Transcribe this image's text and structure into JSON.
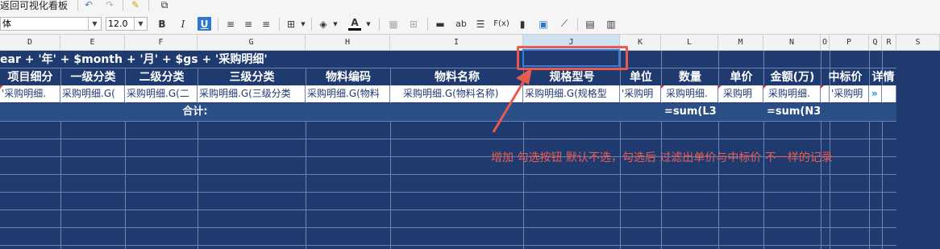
{
  "toolbar": {
    "back_label": "返回可视化看板",
    "font_name": "体",
    "font_size": "12.0",
    "bold": "B",
    "italic": "I",
    "underline": "U",
    "text_btn": "ab",
    "fx_btn": "F(x)",
    "font_color_glyph": "A"
  },
  "columns": [
    "D",
    "E",
    "F",
    "G",
    "H",
    "I",
    "J",
    "K",
    "L",
    "M",
    "N",
    "O",
    "P",
    "Q",
    "R",
    "S"
  ],
  "title_row": "ear + '年' + $month + '月' + $gs + '采购明细'",
  "headers": [
    "项目细分",
    "一级分类",
    "二级分类",
    "三级分类",
    "物料编码",
    "物料名称",
    "规格型号",
    "单位",
    "数量",
    "单价",
    "金额(万)",
    "中标价",
    "详情"
  ],
  "data_row": [
    "'采购明细.",
    "采购明细.G(",
    "采购明细.G(二",
    "采购明细.G(三级分类",
    "采购明细.G(物料",
    "采购明细.G(物料名称)",
    "采购明细.G(规格型",
    "'采购明",
    "采购明细.",
    "采购明",
    "采购明细.",
    "'采购明",
    ""
  ],
  "data_row_chevron": "»",
  "sum_row": {
    "label": "合计:",
    "qty": "=sum(L3",
    "amount": "=sum(N3"
  },
  "annotation": "增加 勾选按钮 默认不选，勾选后 过滤出单价与中标价 不一样的记录",
  "colors": {
    "grid_bg": "#1e3a6e",
    "annotation": "#f05a50",
    "selection": "#3a7bd5"
  }
}
